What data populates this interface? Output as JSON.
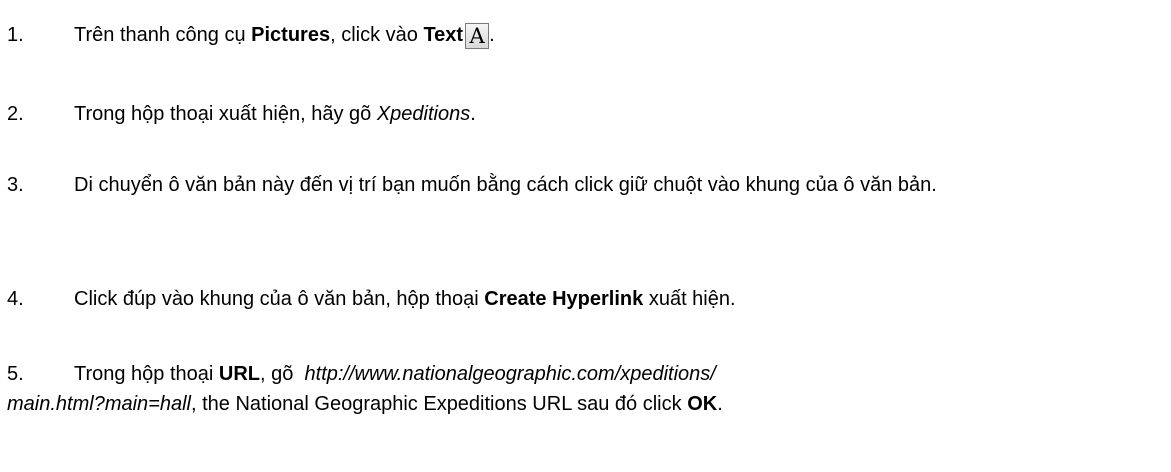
{
  "steps": [
    {
      "number": "1.",
      "parts": [
        "Trên thanh công cụ ",
        "Pictures",
        ", click vào ",
        "Text",
        "."
      ],
      "icon": {
        "name": "text-tool-icon",
        "glyph": "A"
      }
    },
    {
      "number": "2.",
      "parts": [
        "Trong hộp thoại xuất hiện, hãy gõ ",
        "Xpeditions",
        "."
      ]
    },
    {
      "number": "3.",
      "text": "Di chuyển ô văn bản này đến vị trí bạn muốn bằng cách click giữ chuột vào khung của ô văn bản."
    },
    {
      "number": "4.",
      "parts": [
        "Click đúp vào khung của ô văn bản, hộp thoại ",
        "Create Hyperlink",
        " xuất hiện."
      ]
    },
    {
      "number": "5.",
      "parts": [
        "Trong hộp thoại ",
        "URL",
        ", gõ  ",
        "http://www.nationalgeographic.com/xpeditions/",
        "main.html?main=hall",
        ", the National Geographic Expeditions URL sau đó click ",
        "OK",
        "."
      ]
    }
  ]
}
